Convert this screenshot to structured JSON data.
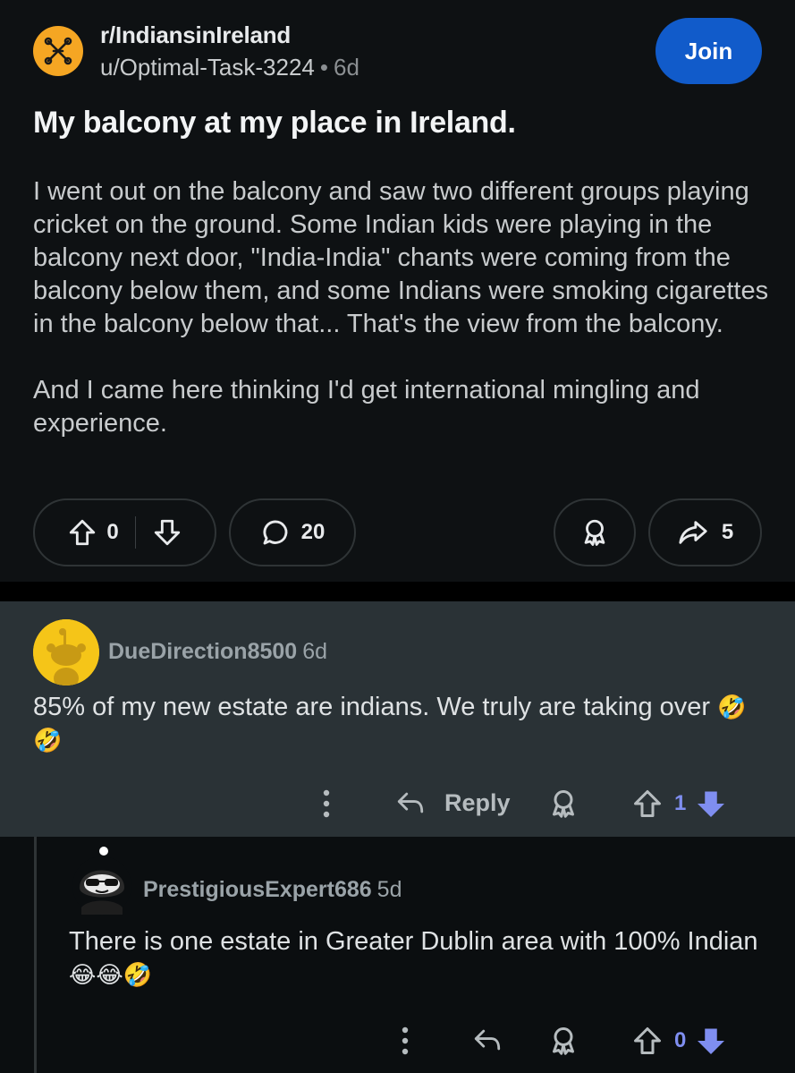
{
  "post": {
    "subreddit": "r/IndiansinIreland",
    "author": "u/Optimal-Task-3224",
    "age": "6d",
    "join_label": "Join",
    "title": "My balcony at my place in Ireland.",
    "body_paragraph_1": "I went out on the balcony and saw two different groups playing cricket on the ground. Some Indian kids were playing in the balcony next door, \"India-India\" chants were coming from the balcony below them, and some Indians were smoking cigarettes in the balcony below that... That's the view from the balcony.",
    "body_paragraph_2": "And I came here thinking I'd get international mingling and experience.",
    "vote_count": "0",
    "comment_count": "20",
    "share_count": "5",
    "accent_color": "#115bca",
    "icons": [
      "subreddit-icon",
      "upvote-icon",
      "downvote-icon",
      "comment-icon",
      "award-icon",
      "share-icon"
    ]
  },
  "comments": [
    {
      "username": "DueDirection8500",
      "age": "6d",
      "text": "85% of my new estate are indians. We truly are taking over",
      "emoji": "🤣🤣",
      "reply_label": "Reply",
      "vote_count": "1",
      "vote_color": "#7f8ef0"
    },
    {
      "username": "PrestigiousExpert686",
      "age": "5d",
      "text": "There is one estate in Greater Dublin area with 100% Indian",
      "emoji": "😂😂🤣",
      "vote_count": "0",
      "vote_color": "#7f8ef0"
    }
  ]
}
